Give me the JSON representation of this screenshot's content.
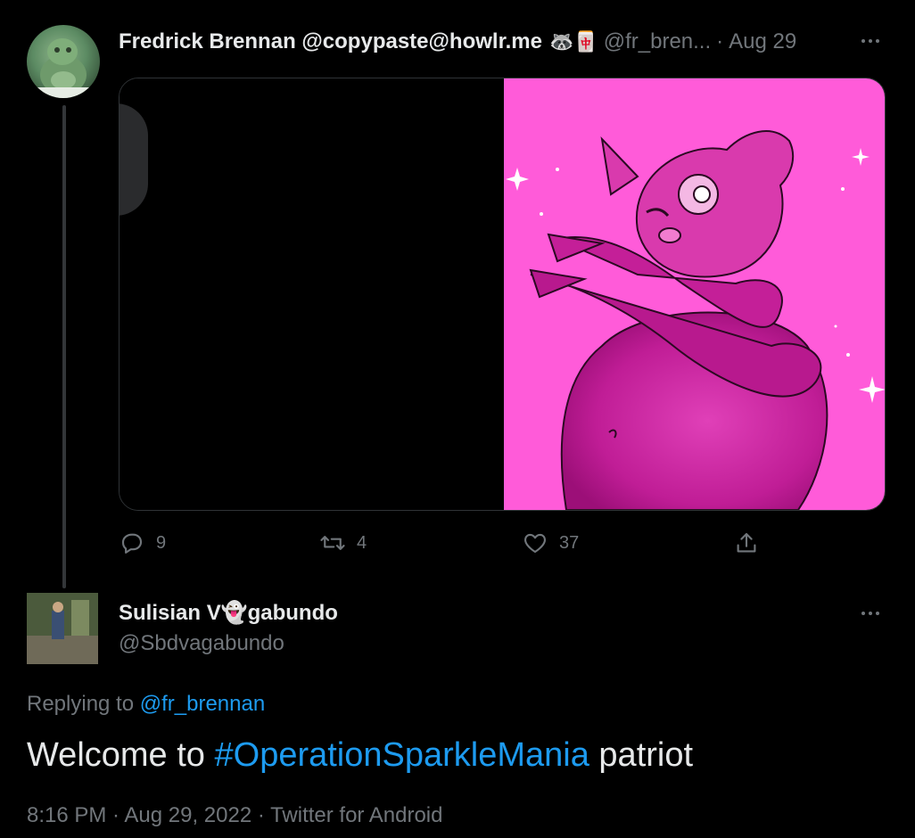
{
  "tweet": {
    "display_name": "Fredrick Brennan @copypaste@howlr.me",
    "emoji": "🦝🀄",
    "handle": "@fr_bren...",
    "dot": "·",
    "date": "Aug 29",
    "actions": {
      "replies": "9",
      "retweets": "4",
      "likes": "37"
    }
  },
  "reply": {
    "display_name": "Sulisian V👻gabundo",
    "handle": "@Sbdvagabundo",
    "replying_prefix": "Replying to",
    "replying_mention": "@fr_brennan",
    "text_before": "Welcome to",
    "hashtag": "#OperationSparkleMania",
    "text_after": "patriot",
    "meta": "8:16 PM · Aug 29, 2022 · Twitter for Android"
  },
  "colors": {
    "background": "#000000",
    "text": "#e7e9ea",
    "muted": "#71767b",
    "link": "#1d9bf0",
    "image_pink": "#ff5bd9"
  },
  "icons": [
    "more-icon",
    "reply-icon",
    "retweet-icon",
    "like-icon",
    "share-icon"
  ]
}
